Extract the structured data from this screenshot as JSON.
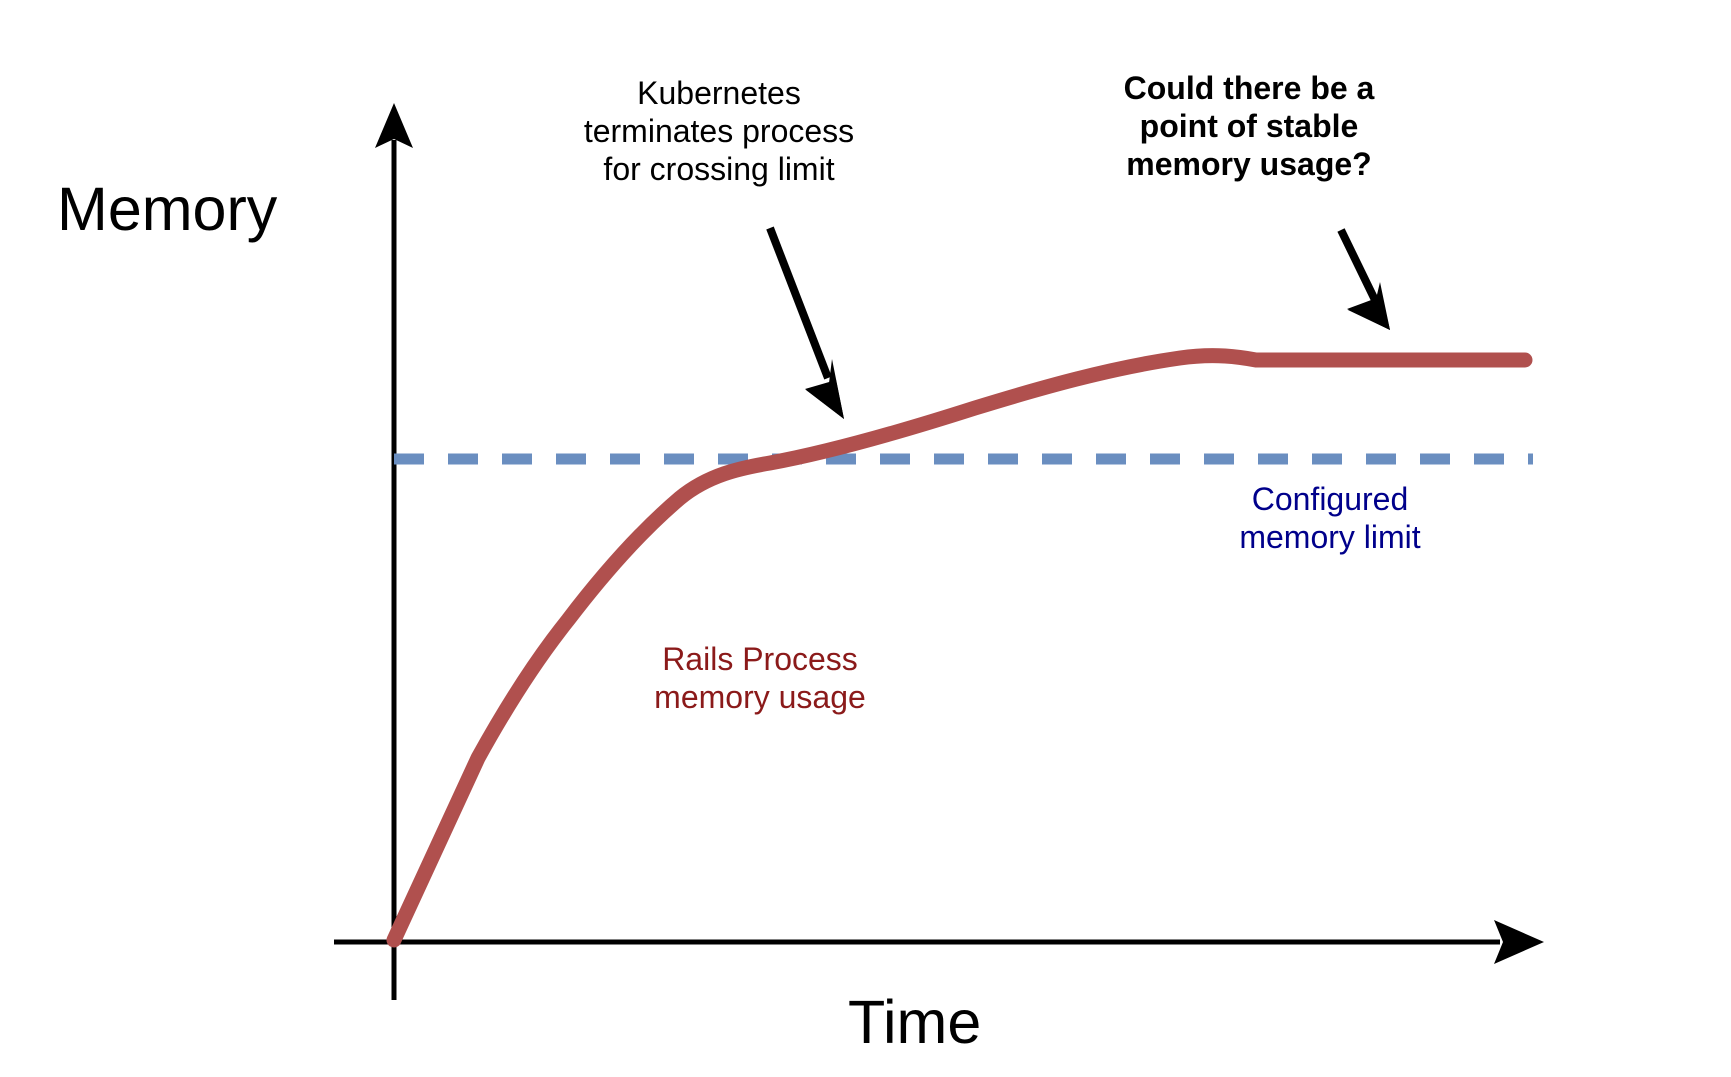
{
  "figure": {
    "background": "#ffffff",
    "axis_color": "#000000",
    "title_color": "#000000"
  },
  "axes": {
    "y_title": "Memory",
    "x_title": "Time"
  },
  "annotations": {
    "kubernetes": {
      "text": "Kubernetes\nterminates process\nfor crossing limit",
      "color": "#000000",
      "bold": false
    },
    "stable_point": {
      "text": "Could there be a\npoint of stable\nmemory usage?",
      "color": "#000000",
      "bold": true
    }
  },
  "series_labels": {
    "rails": {
      "text": "Rails Process\nmemory usage",
      "color": "#8b1a1a"
    },
    "limit": {
      "text": "Configured\nmemory limit",
      "color": "#00008b"
    }
  },
  "chart_data": {
    "type": "line",
    "title": "",
    "xlabel": "Time",
    "ylabel": "Memory",
    "grid": false,
    "legend": "inline-annotations",
    "axis_ticks": false,
    "xlim": [
      0,
      100
    ],
    "ylim": [
      0,
      100
    ],
    "series": [
      {
        "name": "Rails Process memory usage",
        "color": "#b0504e",
        "style": "solid",
        "width": 14,
        "x": [
          0,
          13,
          21,
          30,
          36,
          45,
          55,
          65,
          72,
          80,
          86,
          100
        ],
        "y": [
          0,
          40,
          52,
          60,
          62,
          66,
          70,
          74,
          77,
          80,
          81,
          81
        ]
      },
      {
        "name": "Configured memory limit",
        "color": "#6a8ec0",
        "style": "dashed",
        "width": 9,
        "x": [
          0,
          100
        ],
        "y": [
          63,
          63
        ]
      }
    ],
    "notes": [
      "Rails process memory grows quickly, crosses the configured memory limit, then flattens to a plateau above the limit.",
      "Kubernetes terminates process for crossing limit at the crossing point.",
      "Could there be a point of stable memory usage? points at the plateau."
    ]
  }
}
